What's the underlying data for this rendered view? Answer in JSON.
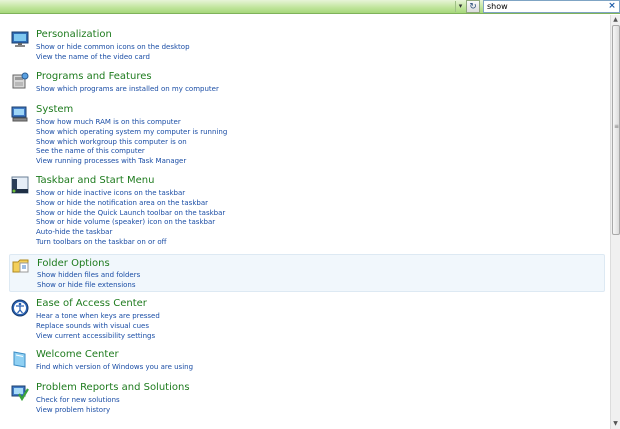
{
  "search": {
    "value": "show",
    "clear_glyph": "×"
  },
  "toolbar": {
    "dropdown_glyph": "▾",
    "refresh_glyph": "↻"
  },
  "scrollbar": {
    "up_glyph": "▲",
    "down_glyph": "▼",
    "grip_glyph": "≡"
  },
  "sections": [
    {
      "title": "Personalization",
      "icon": "personalization-icon",
      "links": [
        "Show or hide common icons on the desktop",
        "View the name of the video card"
      ]
    },
    {
      "title": "Programs and Features",
      "icon": "programs-features-icon",
      "links": [
        "Show which programs are installed on my computer"
      ]
    },
    {
      "title": "System",
      "icon": "system-icon",
      "links": [
        "Show how much RAM is on this computer",
        "Show which operating system my computer is running",
        "Show which workgroup this computer is on",
        "See the name of this computer",
        "View running processes with Task Manager"
      ]
    },
    {
      "title": "Taskbar and Start Menu",
      "icon": "taskbar-icon",
      "links": [
        "Show or hide inactive icons on the taskbar",
        "Show or hide the notification area on the taskbar",
        "Show or hide the Quick Launch toolbar on the taskbar",
        "Show or hide volume (speaker) icon on the taskbar",
        "Auto-hide the taskbar",
        "Turn toolbars on the taskbar on or off"
      ]
    },
    {
      "title": "Folder Options",
      "icon": "folder-options-icon",
      "links": [
        "Show hidden files and folders",
        "Show or hide file extensions"
      ]
    },
    {
      "title": "Ease of Access Center",
      "icon": "ease-of-access-icon",
      "links": [
        "Hear a tone when keys are pressed",
        "Replace sounds with visual cues",
        "View current accessibility settings"
      ]
    },
    {
      "title": "Welcome Center",
      "icon": "welcome-center-icon",
      "links": [
        "Find which version of Windows you are using"
      ]
    },
    {
      "title": "Problem Reports and Solutions",
      "icon": "problem-reports-icon",
      "links": [
        "Check for new solutions",
        "View problem history"
      ]
    }
  ]
}
